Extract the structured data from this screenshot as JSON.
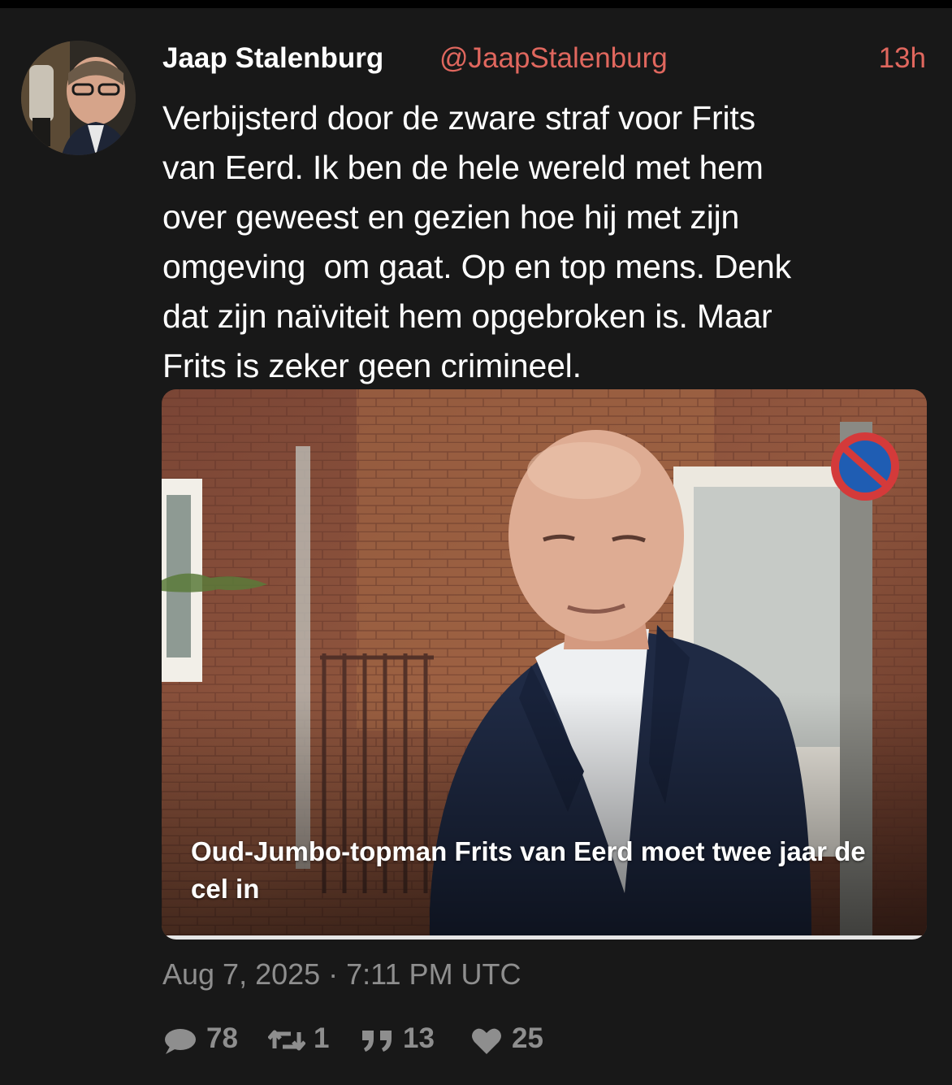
{
  "tweet": {
    "author": {
      "name": "Jaap Stalenburg",
      "handle": "@JaapStalenburg"
    },
    "time_ago": "13h",
    "text": "Verbijsterd door de zware straf voor Frits\nvan Eerd. Ik ben de hele wereld met hem\nover geweest en gezien hoe hij met zijn\nomgeving  om gaat. Op en top mens. Denk\ndat zijn naïviteit hem opgebroken is. Maar\nFrits is zeker geen crimineel.",
    "card": {
      "headline": "Oud-Jumbo-topman Frits van Eerd moet twee jaar de cel in"
    },
    "date": "Aug 7, 2025 · 7:11 PM UTC",
    "stats": {
      "replies": "78",
      "retweets": "1",
      "quotes": "13",
      "likes": "25"
    }
  },
  "colors": {
    "background": "#181818",
    "text": "#ffffff",
    "accent": "#e0675e",
    "muted": "#8e8e8e"
  },
  "icons": {
    "replies": "comment-icon",
    "retweets": "retweet-icon",
    "quotes": "quote-icon",
    "likes": "heart-icon"
  }
}
